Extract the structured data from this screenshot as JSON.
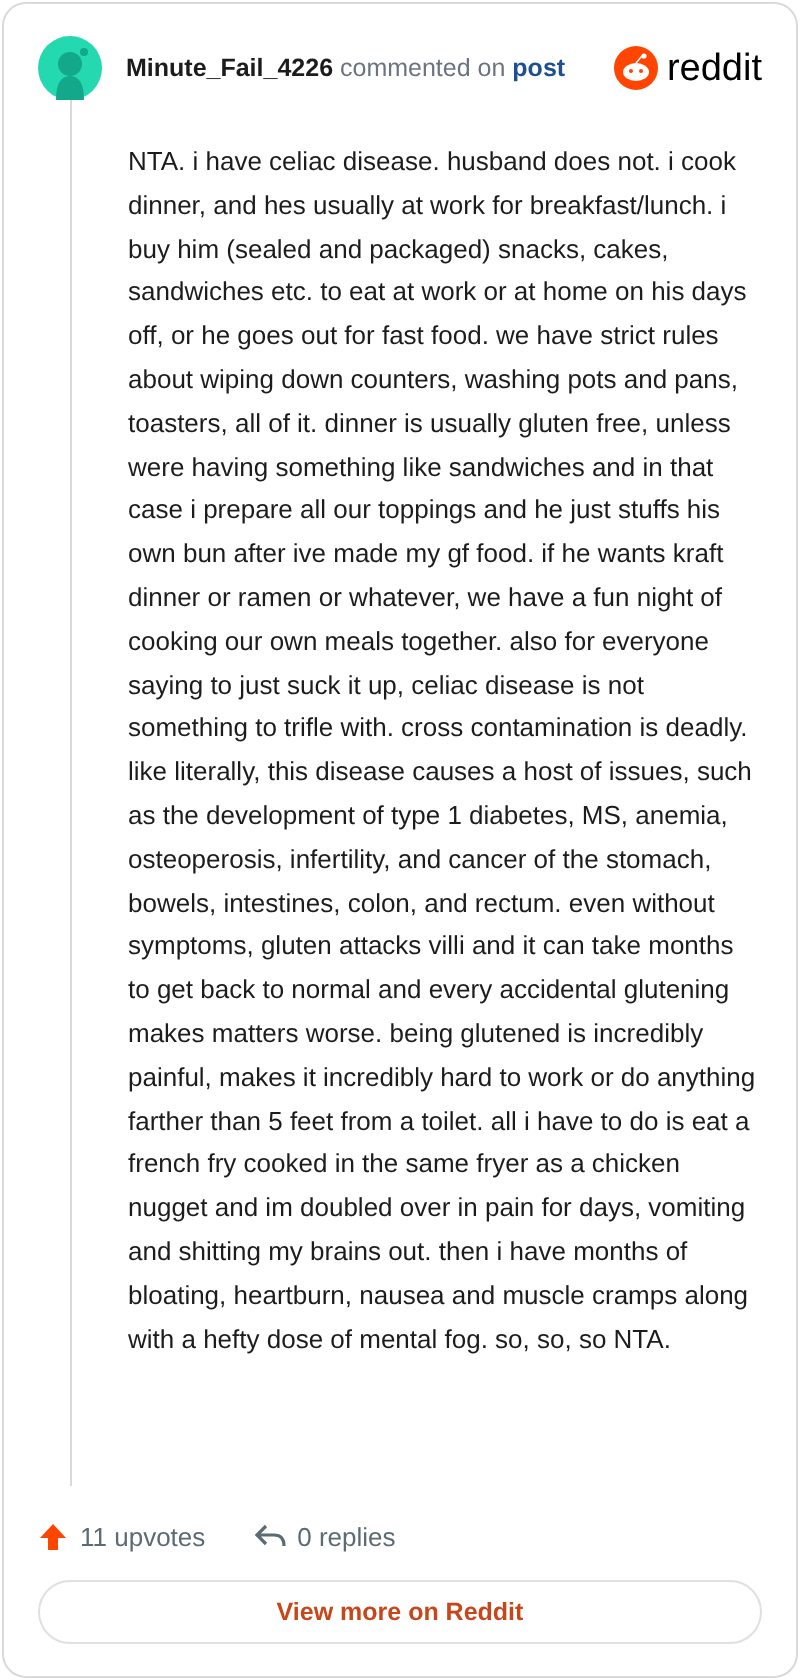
{
  "comment": {
    "author": "Minute_Fail_4226",
    "action": "commented on",
    "target": "post",
    "brand": "reddit",
    "body": "NTA. i have celiac disease. husband does not. i cook dinner, and hes usually at work for breakfast/lunch. i buy him (sealed and packaged) snacks, cakes, sandwiches etc. to eat at work or at home on his days off, or he goes out for fast food. we have strict rules about wiping down counters, washing pots and pans, toasters, all of it. dinner is usually gluten free, unless were having something like sandwiches and in that case i prepare all our toppings and he just stuffs his own bun after ive made my gf food. if he wants kraft dinner or ramen or whatever, we have a fun night of cooking our own meals together. also for everyone saying to just suck it up, celiac disease is not something to trifle with. cross contamination is deadly. like literally, this disease causes a host of issues, such as the development of type 1 diabetes, MS, anemia, osteoperosis, infertility, and cancer of the stomach, bowels, intestines, colon, and rectum. even without symptoms, gluten attacks villi and it can take months to get back to normal and every accidental glutening makes matters worse. being glutened is incredibly painful, makes it incredibly hard to work or do anything farther than 5 feet from a toilet. all i have to do is eat a french fry cooked in the same fryer as a chicken nugget and im doubled over in pain for days, vomiting and shitting my brains out. then i have months of bloating, heartburn, nausea and muscle cramps along with a hefty dose of mental fog. so, so, so NTA.",
    "upvotes": "11 upvotes",
    "replies": "0 replies",
    "button": "View more on Reddit"
  }
}
